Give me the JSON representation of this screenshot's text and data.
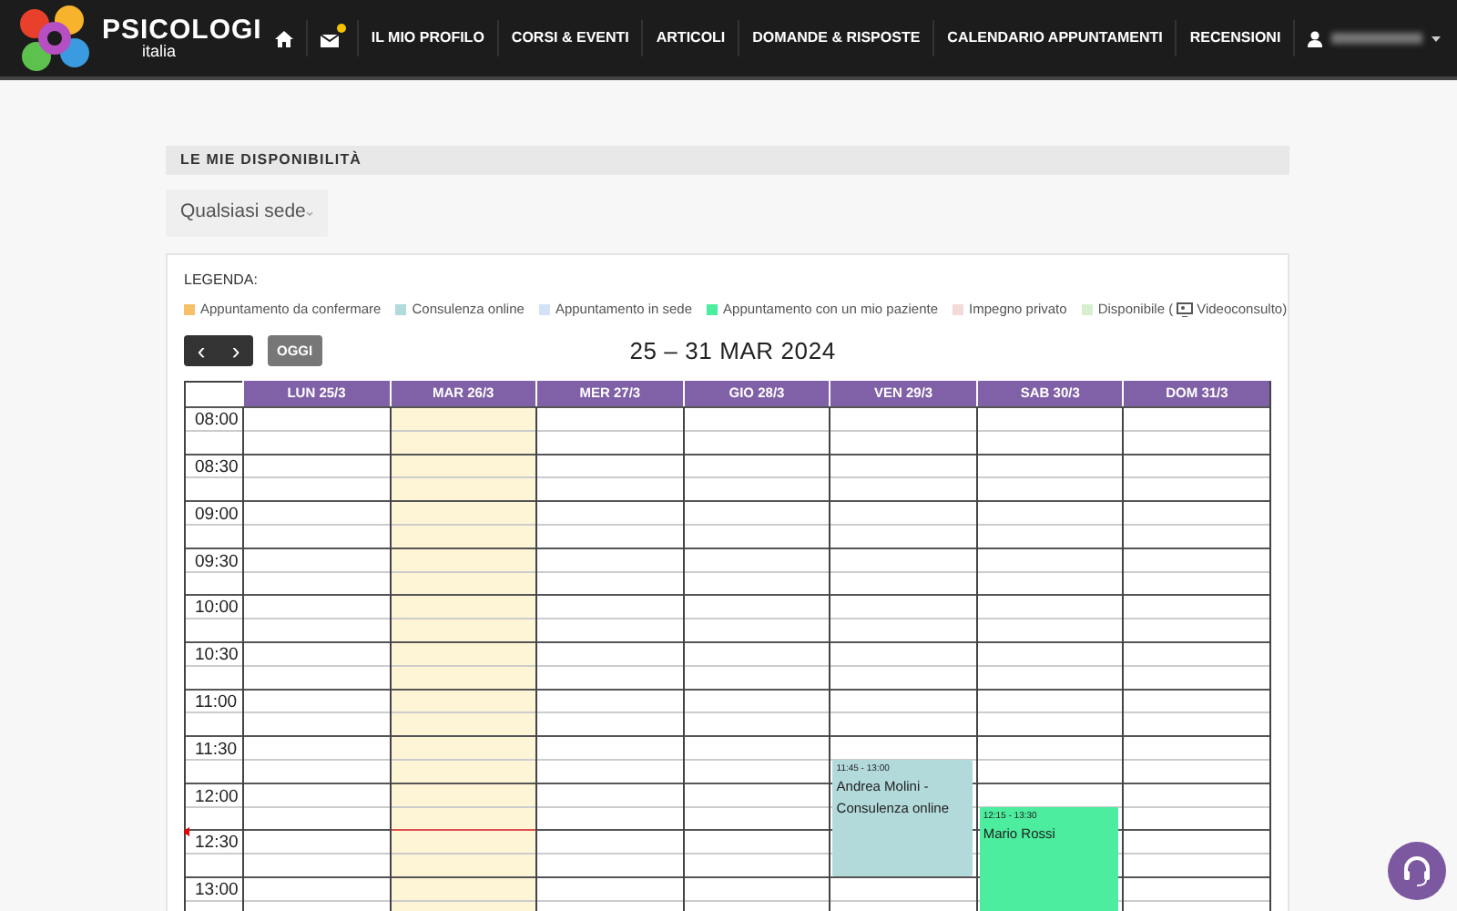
{
  "brand": {
    "name": "PSICOLOGI",
    "sub": "italia"
  },
  "nav": [
    {
      "kind": "home"
    },
    {
      "kind": "messages",
      "badge": true
    },
    {
      "kind": "text",
      "label": "IL MIO PROFILO"
    },
    {
      "kind": "text",
      "label": "CORSI & EVENTI"
    },
    {
      "kind": "text",
      "label": "ARTICOLI"
    },
    {
      "kind": "text",
      "label": "DOMANDE & RISPOSTE"
    },
    {
      "kind": "text",
      "label": "CALENDARIO APPUNTAMENTI"
    },
    {
      "kind": "text",
      "label": "RECENSIONI"
    },
    {
      "kind": "user"
    }
  ],
  "section_title": "LE MIE DISPONIBILITÀ",
  "location_select": {
    "value": "Qualsiasi sede"
  },
  "legend": {
    "title": "LEGENDA:",
    "items": [
      {
        "label": "Appuntamento da confermare",
        "color": "#f7c068"
      },
      {
        "label": "Consulenza online",
        "color": "#b3dadb"
      },
      {
        "label": "Appuntamento in sede",
        "color": "#d3e3f7"
      },
      {
        "label": "Appuntamento con un mio paziente",
        "color": "#4ced9e"
      },
      {
        "label": "Impegno privato",
        "color": "#f5dada"
      },
      {
        "label": "Disponibile (",
        "suffix": "Videoconsulto)",
        "color": "#d6f0cf"
      }
    ]
  },
  "toolbar": {
    "prev": "‹",
    "next": "›",
    "today": "OGGI",
    "range": "25 – 31 MAR 2024"
  },
  "calendar": {
    "days": [
      {
        "label": "LUN 25/3",
        "today": false
      },
      {
        "label": "MAR 26/3",
        "today": true,
        "now_line": {
          "level": 0.82
        }
      },
      {
        "label": "MER 27/3",
        "today": false
      },
      {
        "label": "GIO 28/3",
        "today": false
      },
      {
        "label": "VEN 29/3",
        "today": false,
        "events": [
          {
            "time": "11:45 - 13:00",
            "title": "Andrea Molini - Consulenza online",
            "color": "#b3dadb"
          }
        ]
      },
      {
        "label": "SAB 30/3",
        "today": false,
        "events": [
          {
            "time": "12:15 - 13:30",
            "title": "Mario Rossi",
            "color": "#4ced9e"
          }
        ]
      },
      {
        "label": "DOM 31/3",
        "today": false
      }
    ],
    "times": [
      "08:00",
      "08:30",
      "09:00",
      "09:30",
      "10:00",
      "10:30",
      "11:00",
      "11:30",
      "12:00",
      "12:30",
      "13:00"
    ]
  }
}
